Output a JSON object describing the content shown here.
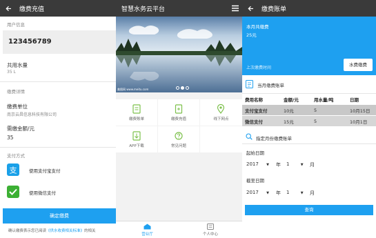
{
  "screen1": {
    "title": "缴费充值",
    "user_info_label": "用户信息",
    "account_number": "123456789",
    "shared_water_label": "共用水量",
    "shared_water_value": "35 L",
    "payment_details_label": "缴费详情",
    "payee_label": "缴费单位",
    "payee_value": "南京云昌信息科技有限公司",
    "amount_label": "需缴金额/元",
    "amount_value": "35",
    "payment_method_label": "支付方式",
    "alipay_label": "使用支付宝支付",
    "wechat_label": "使用微信支付",
    "confirm_button": "确定缴费",
    "agreement_prefix": "确认缴费表示您已阅读",
    "agreement_link": "《供水收费相关标准》",
    "agreement_suffix": "的相关"
  },
  "screen2": {
    "title": "智慧水务云平台",
    "banner_caption": "美图网 www.meitu.com",
    "tiles": [
      {
        "label": "缴费账单",
        "icon": "bill-icon"
      },
      {
        "label": "缴费充值",
        "icon": "recharge-icon"
      },
      {
        "label": "线下网点",
        "icon": "location-icon"
      },
      {
        "label": "APP下载",
        "icon": "download-icon"
      },
      {
        "label": "常见问题",
        "icon": "question-icon"
      }
    ],
    "nav_hall": "营业厅",
    "nav_profile": "个人中心",
    "colors": {
      "accent": "#1ea0f0"
    }
  },
  "screen3": {
    "title": "缴费账单",
    "month_total_label": "本月共缴费",
    "month_total_value": "25元",
    "last_payment_label": "上次缴费时间",
    "water_bill_button": "水费缴费",
    "current_bills_label": "当月缴费账单",
    "table_headers": [
      "费用名称",
      "金额/元",
      "用水量/吨",
      "日期"
    ],
    "table_rows": [
      [
        "支付宝支付",
        "10元",
        "5",
        "10月15日"
      ],
      [
        "微信支付",
        "15元",
        "5",
        "10月1日"
      ]
    ],
    "query_label": "指定月份缴费账单",
    "start_date_label": "起始日期",
    "end_date_label": "截至日期",
    "start_year": "2017",
    "start_month": "1",
    "end_year": "2017",
    "end_month": "1",
    "year_unit": "年",
    "month_unit": "月",
    "query_button": "查询",
    "colors": {
      "banner": "#1ea0f0",
      "table_row": "#d6d6d6"
    }
  }
}
